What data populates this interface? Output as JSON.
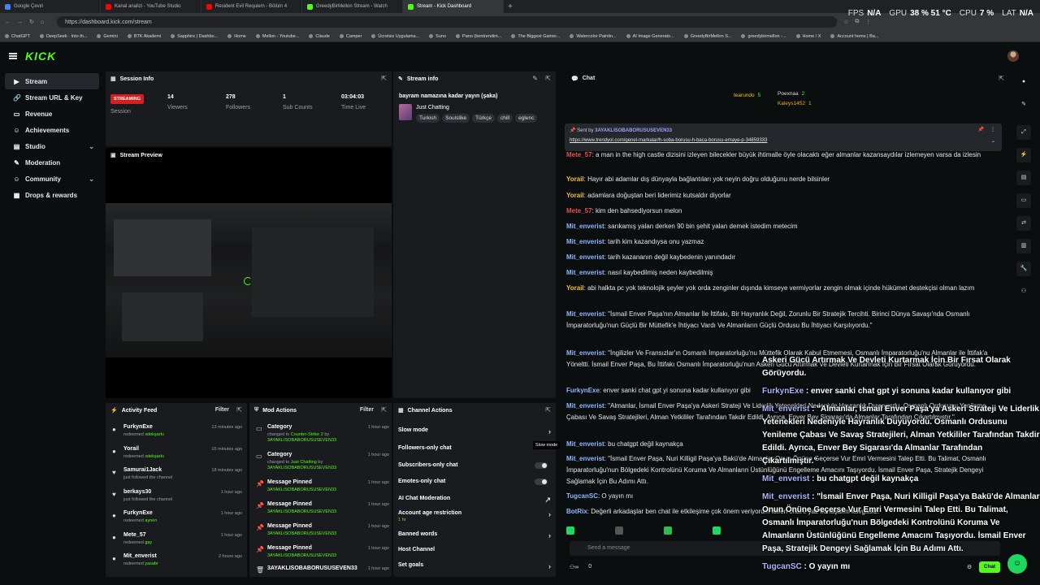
{
  "browser": {
    "tabs": [
      {
        "title": "Google Çeviri",
        "color": "#4285f4"
      },
      {
        "title": "Kanal analizi - YouTube Studio",
        "color": "#ff0000"
      },
      {
        "title": "Resident Evil Requiem - Bölüm 4",
        "color": "#ff0000"
      },
      {
        "title": "GreedyBirMellon Stream - Watch",
        "color": "#53fc18"
      },
      {
        "title": "Stream - Kick Dashboard",
        "color": "#53fc18"
      }
    ],
    "newtab": "+",
    "url": "https://dashboard.kick.com/stream",
    "perf": [
      {
        "k": "FPS",
        "v": "N/A"
      },
      {
        "k": "GPU",
        "v": "38 % 51 °C"
      },
      {
        "k": "CPU",
        "v": "7 %"
      },
      {
        "k": "LAT",
        "v": "N/A"
      }
    ],
    "bookmarks": [
      "ChatGPT",
      "DeepSeek - Into th...",
      "Gemini",
      "BTK Akademi",
      "Sapphire | Dashbo...",
      "Home",
      "Mellon - Youtube...",
      "Claude",
      "Camper",
      "Ücretsiz Uygulama...",
      "Suno",
      "Pano (bentrendim...",
      "The Biggest Gamer...",
      "Watercolor Paintin...",
      "AI Image Generato...",
      "GreedyBirMellon S...",
      "greedybirmellon -...",
      "Home / X",
      "Account home | Ba..."
    ]
  },
  "header": {
    "logo": "KICK"
  },
  "sidebar": {
    "items": [
      {
        "label": "Stream",
        "icon": "▶",
        "active": true
      },
      {
        "label": "Stream URL & Key",
        "icon": "🔗"
      },
      {
        "label": "Revenue",
        "icon": "▭"
      },
      {
        "label": "Achievements",
        "icon": "☺"
      },
      {
        "label": "Studio",
        "icon": "▤",
        "chev": "⌄"
      },
      {
        "label": "Moderation",
        "icon": "✎"
      },
      {
        "label": "Community",
        "icon": "☺",
        "chev": "⌄"
      },
      {
        "label": "Drops & rewards",
        "icon": "▦"
      }
    ]
  },
  "session": {
    "title": "Session Info",
    "status": "STREAMING",
    "status_label": "Session",
    "stats": [
      {
        "value": "14",
        "label": "Viewers"
      },
      {
        "value": "278",
        "label": "Followers"
      },
      {
        "value": "1",
        "label": "Sub Counts"
      },
      {
        "value": "03:04:03",
        "label": "Time Live"
      }
    ]
  },
  "stream_info": {
    "title": "Stream info",
    "stream_title": "bayram namazına kadar yayın (şaka)",
    "category": "Just Chatting",
    "tags": [
      "Turkish",
      "Soulslike",
      "Türkçe",
      "chill",
      "eglenc"
    ]
  },
  "preview": {
    "title": "Stream Preview"
  },
  "activity": {
    "title": "Activity Feed",
    "filter": "Filter",
    "items": [
      {
        "who": "FurkynExe",
        "what": "redeemed",
        "reward": "ıstekşarkı",
        "when": "13 minutes ago",
        "icon": "●"
      },
      {
        "who": "Yorail",
        "what": "redeemed",
        "reward": "ıstekşarkı",
        "when": "15 minutes ago",
        "icon": "●"
      },
      {
        "who": "Samurai1Jack",
        "what": "just followed the channel",
        "reward": "",
        "when": "18 minutes ago",
        "icon": "♥"
      },
      {
        "who": "berkays30",
        "what": "just followed the channel",
        "reward": "",
        "when": "1 hour ago",
        "icon": "♥"
      },
      {
        "who": "FurkynExe",
        "what": "redeemed",
        "reward": "aynen",
        "when": "1 hour ago",
        "icon": "●"
      },
      {
        "who": "Mete_57",
        "what": "redeemed",
        "reward": "gay",
        "when": "1 hour ago",
        "icon": "●"
      },
      {
        "who": "Mit_enverist",
        "what": "redeemed",
        "reward": "yasabr",
        "when": "2 hours ago",
        "icon": "●"
      }
    ]
  },
  "mod": {
    "title": "Mod Actions",
    "filter": "Filter",
    "items": [
      {
        "t": "Category",
        "pre": "changed to",
        "val": "Counter-Strike 2",
        "post": "by",
        "user": "3AYAKLISOBABORUSUSEVEN33",
        "when": "1 hour ago"
      },
      {
        "t": "Category",
        "pre": "changed to",
        "val": "Just Chatting",
        "post": "by",
        "user": "3AYAKLISOBABORUSUSEVEN33",
        "when": "1 hour ago"
      },
      {
        "t": "Message Pinned",
        "user": "3AYAKLISOBABORUSUSEVEN33",
        "when": "1 hour ago"
      },
      {
        "t": "Message Pinned",
        "user": "3AYAKLISOBABORUSUSEVEN33",
        "when": "1 hour ago"
      },
      {
        "t": "Message Pinned",
        "user": "3AYAKLISOBABORUSUSEVEN33",
        "when": "1 hour ago"
      },
      {
        "t": "Message Pinned",
        "user": "3AYAKLISOBABORUSUSEVEN33",
        "when": "1 hour ago"
      },
      {
        "t": "3AYAKLISOBABORUSUSEVEN33",
        "user": "",
        "when": "1 hour ago"
      }
    ]
  },
  "channel_actions": {
    "title": "Channel Actions",
    "rows": [
      {
        "label": "Slow mode",
        "kind": "arrow"
      },
      {
        "label": "Followers-only chat",
        "kind": "none"
      },
      {
        "label": "Subscribers-only chat",
        "kind": "toggle"
      },
      {
        "label": "Emotes-only chat",
        "kind": "toggle"
      },
      {
        "label": "AI Chat Moderation",
        "kind": "link"
      },
      {
        "label": "Account age restriction",
        "sub": "1 hr",
        "kind": "arrow"
      },
      {
        "label": "Banned words",
        "kind": "arrow"
      },
      {
        "label": "Host Channel",
        "kind": "none"
      },
      {
        "label": "Set goals",
        "kind": "arrow"
      }
    ],
    "tooltip": "Slow mode"
  },
  "chat": {
    "title": "Chat",
    "leaders": [
      {
        "name": "tearundo",
        "count": "5"
      },
      {
        "name": "Poexnaa",
        "count": "2"
      },
      {
        "name": "Kaleys1452",
        "count": "1"
      }
    ],
    "pinned": {
      "sent_by": "Sent by",
      "user": "3AYAKLISOBABORUSUSEVEN33",
      "link": "https://www.trendyol.com/genel-markalar/h-soba-borusu-h-baca-borusu-emaye-p-34859333"
    },
    "messages": [
      {
        "name": "Mete_57",
        "color": "#e05252",
        "text": "a man in the high castle dizisini izleyen bilecekler büyük ihtimalle öyle olacaktı eğer almanlar kazansaydılar izlemeyen varsa da izlesin"
      },
      {
        "name": "Yorail",
        "color": "#f2c318",
        "text": "Hayır abi adamlar dış dünyayla bağlantıları yok neyin doğru olduğunu nerde bilsinler"
      },
      {
        "name": "Yorail",
        "color": "#f2c318",
        "text": "adamlara doğuştan beri liderimiz kutsaldır diyorlar"
      },
      {
        "name": "Mete_57",
        "color": "#e05252",
        "text": "kim den bahsediyorsun melon"
      },
      {
        "name": "Mit_enverist",
        "color": "#8fb6ff",
        "text": "sarıkamış yalan derken 90 bin şehit yalan demek istedim metecim"
      },
      {
        "name": "Mit_enverist",
        "color": "#8fb6ff",
        "text": "tarih kim kazandıysa onu yazmaz"
      },
      {
        "name": "Mit_enverist",
        "color": "#8fb6ff",
        "text": "tarih kazananın değil kaybedenin yanındadır"
      },
      {
        "name": "Mit_enverist",
        "color": "#8fb6ff",
        "text": "nasıl kaybedilmiş neden kaybedilmiş"
      },
      {
        "name": "Yorail",
        "color": "#f2c318",
        "text": "abi halkta pc yok teknolojik şeyler yok orda zenginler dışında kimseye vermiyorlar zengin olmak içinde hükümet destekçisi olman lazım"
      },
      {
        "name": "Mit_enverist",
        "color": "#8fb6ff",
        "text": "\"İsmail Enver Paşa'nın Almanlar İle İttifakı, Bir Hayranlık Değil, Zorunlu Bir Stratejik Tercihti. Birinci Dünya Savaşı'nda Osmanlı İmparatorluğu'nun Güçlü Bir Müttefik'e İhtiyacı Vardı Ve Almanların Güçlü Ordusu Bu İhtiyacı Karşılıyordu.\""
      },
      {
        "name": "Mit_enverist",
        "color": "#8fb6ff",
        "text": "\"İngilizler Ve Fransızlar'ın Osmanlı İmparatorluğu'nu Müttefik Olarak Kabul Etmemesi, Osmanlı İmparatorluğu'nu Almanlar ile İttifak'a Yöneltti. İsmail Enver Paşa, Bu İttifakı Osmanlı İmparatorluğu'nun Askeri Gücü Artırmak Ve Devleti Kurtarmak İçin Bir Fırsat Olarak Görüyordu."
      },
      {
        "name": "FurkynExe",
        "color": "#8fb6ff",
        "text": "enver sanki chat gpt yi sonuna kadar kullanıyor gibi"
      },
      {
        "name": "Mit_enverist",
        "color": "#8fb6ff",
        "text": "\"Almanlar, İsmail Enver Paşa'ya Askeri Strateji Ve Liderlik Yetenekleri Nedeniyle Hayranlık Duyuyordu. Osmanlı Ordusunu Yenileme Çabası Ve Savaş Stratejileri, Alman Yetkililer Tarafından Takdir Edildi. Ayrıca, Enver Bey Sigarası'da Almanlar Tarafından Çıkartılmıştır.\""
      },
      {
        "name": "Mit_enverist",
        "color": "#8fb6ff",
        "text": "bu chatgpt değil kaynakça"
      },
      {
        "name": "Mit_enverist",
        "color": "#8fb6ff",
        "text": "\"İsmail Enver Paşa, Nuri Killigil Paşa'ya Bakü'de Almanlar Onun Önüne Geçerse Vur Emri Vermesini Talep Etti. Bu Talimat, Osmanlı İmparatorluğu'nun Bölgedeki Kontrolünü Koruma Ve Almanların Üstünlüğünü Engelleme Amacını Taşıyordu. İsmail Enver Paşa, Stratejik Dengeyi Sağlamak İçin Bu Adımı Attı."
      },
      {
        "name": "TugcanSC",
        "color": "#8fb6ff",
        "text": "O yayın mı"
      },
      {
        "name": "BotRix",
        "color": "#8fb6ff",
        "text": "Değerli arkadaşlar ben chat ile etkileşime çok önem veriyorum lütfen chat'e yaz konuşalım kavgasız!"
      }
    ],
    "input_placeholder": "Send a message",
    "viewers_count": "0",
    "send_label": "Chat"
  },
  "overlay": {
    "lines": [
      {
        "name": "",
        "text": "Askeri Gücü Artırmak Ve Devleti Kurtarmak İçin Bir Fırsat Olarak Görüyordu."
      },
      {
        "name": "FurkynExe",
        "text": ": enver sanki chat gpt yi sonuna kadar kullanıyor gibi"
      },
      {
        "name": "Mit_enverist",
        "text": ": \"Almanlar, İsmail Enver Paşa'ya Askeri Strateji Ve Liderlik Yetenekleri Nedeniyle Hayranlık Duyuyordu. Osmanlı Ordusunu Yenileme Çabası Ve Savaş Stratejileri, Alman Yetkililer Tarafından Takdir Edildi. Ayrıca, Enver Bey Sigarası'da Almanlar Tarafından Çıkartılmıştır.\""
      },
      {
        "name": "Mit_enverist",
        "text": ": bu chatgpt değil kaynakça"
      },
      {
        "name": "Mit_enverist",
        "text": ": \"İsmail Enver Paşa, Nuri Killigil Paşa'ya Bakü'de Almanlar Onun Önüne Geçerse Vur Emri Vermesini Talep Etti. Bu Talimat, Osmanlı İmparatorluğu'nun Bölgedeki Kontrolünü Koruma Ve Almanların Üstünlüğünü Engelleme Amacını Taşıyordu. İsmail Enver Paşa, Stratejik Dengeyi Sağlamak İçin Bu Adımı Attı."
      },
      {
        "name": "TugcanSC",
        "text": ": O yayın mı"
      }
    ]
  },
  "colors": {
    "accent": "#53fc18",
    "live": "#d0211f",
    "panel": "#191b1f"
  }
}
